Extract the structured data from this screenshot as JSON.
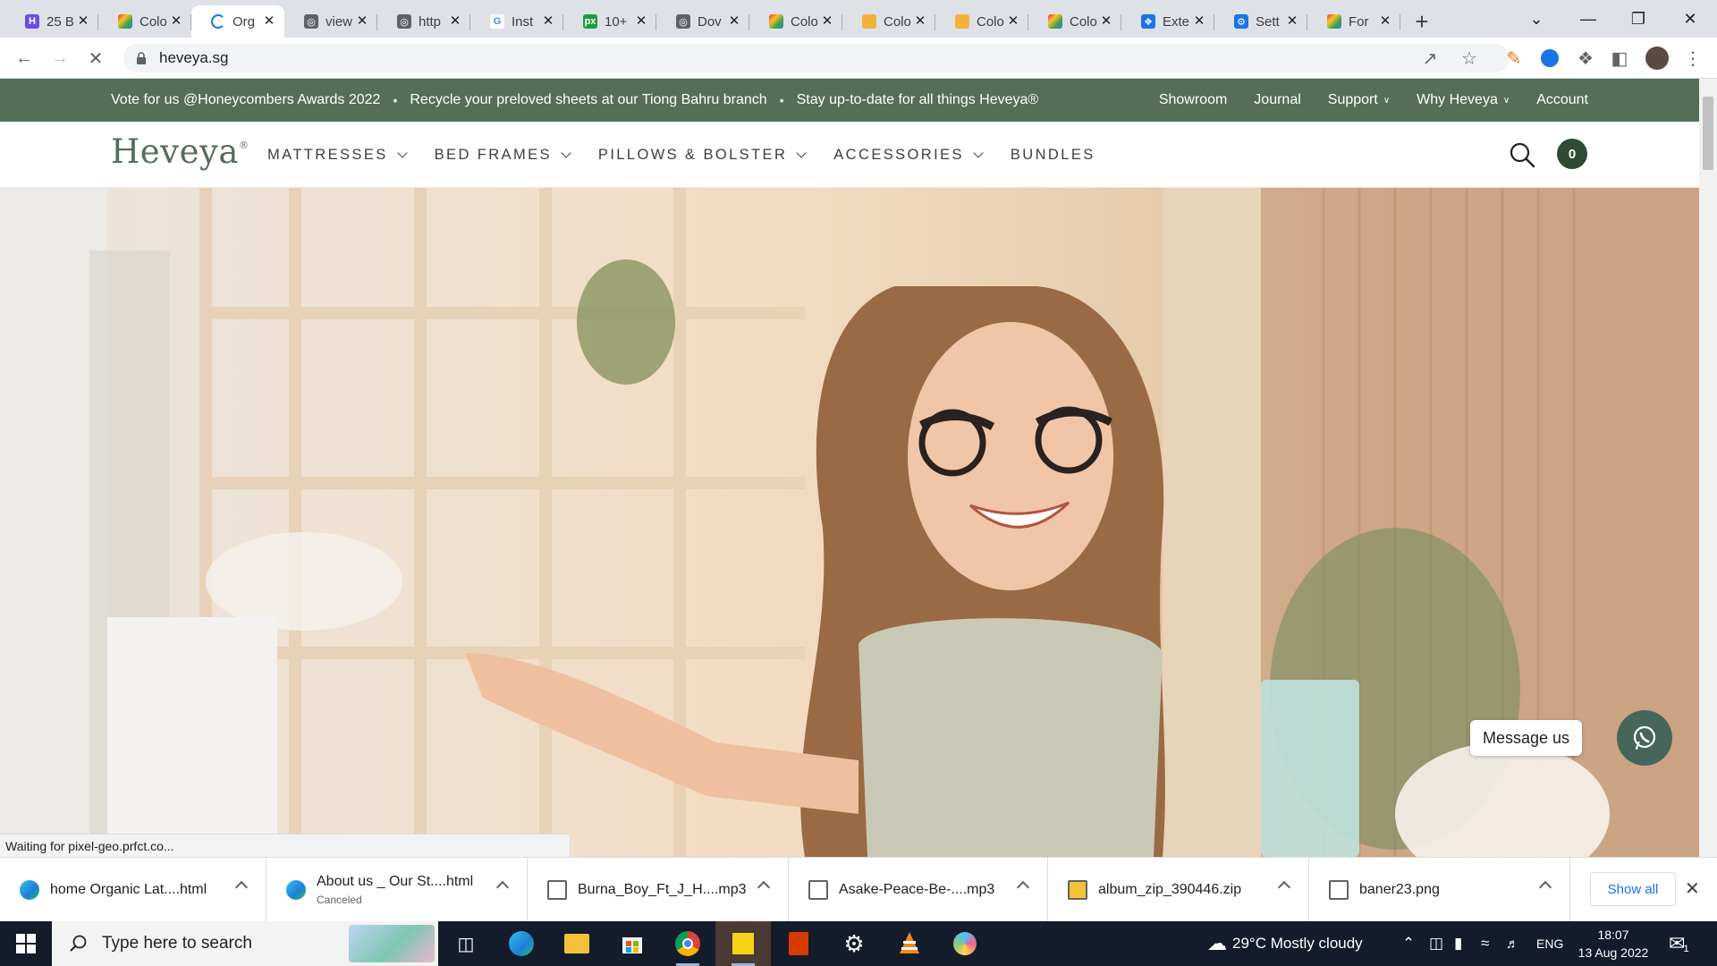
{
  "browser": {
    "tabs": [
      {
        "title": "25 B",
        "favicon": "purple-h-icon",
        "active": false
      },
      {
        "title": "Colo",
        "favicon": "rainbow-icon",
        "active": false
      },
      {
        "title": "Org",
        "favicon": "loading-spinner-icon",
        "active": true
      },
      {
        "title": "view",
        "favicon": "globe-icon",
        "active": false
      },
      {
        "title": "http",
        "favicon": "globe-icon",
        "active": false
      },
      {
        "title": "Inst",
        "favicon": "google-g-icon",
        "active": false
      },
      {
        "title": "10+",
        "favicon": "px-icon",
        "active": false
      },
      {
        "title": "Dov",
        "favicon": "globe-icon",
        "active": false
      },
      {
        "title": "Colo",
        "favicon": "rainbow-icon",
        "active": false
      },
      {
        "title": "Colo",
        "favicon": "yellow-hands-icon",
        "active": false
      },
      {
        "title": "Colo",
        "favicon": "yellow-hands-icon",
        "active": false
      },
      {
        "title": "Colo",
        "favicon": "rainbow-icon",
        "active": false
      },
      {
        "title": "Exte",
        "favicon": "puzzle-icon",
        "active": false
      },
      {
        "title": "Sett",
        "favicon": "gear-icon",
        "active": false
      },
      {
        "title": "For",
        "favicon": "rainbow-icon",
        "active": false
      }
    ],
    "url": "heveya.sg",
    "status_text": "Waiting for pixel-geo.prfct.co..."
  },
  "site": {
    "announcements": [
      "Vote for us @Honeycombers Awards 2022",
      "Recycle your preloved sheets at our Tiong Bahru branch",
      "Stay up-to-date for all things Heveya®"
    ],
    "separator": "•",
    "top_links": [
      {
        "label": "Showroom",
        "dropdown": false
      },
      {
        "label": "Journal",
        "dropdown": false
      },
      {
        "label": "Support",
        "dropdown": true
      },
      {
        "label": "Why Heveya",
        "dropdown": true
      },
      {
        "label": "Account",
        "dropdown": false
      }
    ],
    "logo": "Heveya",
    "logo_mark": "®",
    "nav": [
      {
        "label": "MATTRESSES",
        "dropdown": true
      },
      {
        "label": "BED FRAMES",
        "dropdown": true
      },
      {
        "label": "PILLOWS & BOLSTER",
        "dropdown": true
      },
      {
        "label": "ACCESSORIES",
        "dropdown": true
      },
      {
        "label": "BUNDLES",
        "dropdown": false
      }
    ],
    "cart_count": "0",
    "message_label": "Message us",
    "colors": {
      "brand_green": "#546e58",
      "cart_dark": "#2f4a35",
      "whatsapp_bg": "#46665a"
    }
  },
  "downloads": {
    "items": [
      {
        "name": "home Organic Lat....html",
        "sub": "",
        "icon": "edge-icon"
      },
      {
        "name": "About us _ Our St....html",
        "sub": "Canceled",
        "icon": "edge-icon"
      },
      {
        "name": "Burna_Boy_Ft_J_H....mp3",
        "sub": "",
        "icon": "audio-file-icon"
      },
      {
        "name": "Asake-Peace-Be-....mp3",
        "sub": "",
        "icon": "audio-file-icon"
      },
      {
        "name": "album_zip_390446.zip",
        "sub": "",
        "icon": "zip-file-icon"
      },
      {
        "name": "baner23.png",
        "sub": "",
        "icon": "image-file-icon"
      }
    ],
    "show_all": "Show all"
  },
  "taskbar": {
    "search_placeholder": "Type here to search",
    "weather": "29°C  Mostly cloudy",
    "language": "ENG",
    "time": "18:07",
    "date": "13 Aug 2022",
    "notification_count": "1"
  }
}
